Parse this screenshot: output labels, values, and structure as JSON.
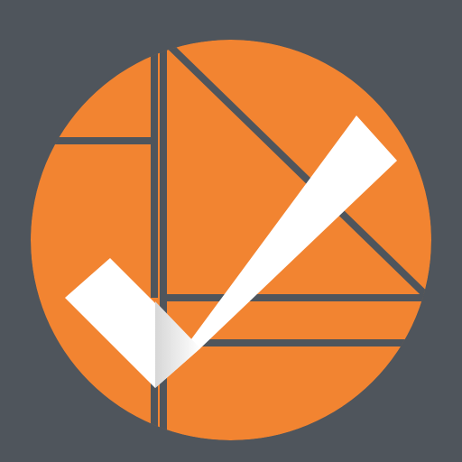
{
  "app_icon": {
    "icon": "checkmark-play-logo-icon",
    "colors": {
      "background": "#4f555c",
      "circle": "#f28431",
      "divider": "#4f555c",
      "check_mark": "#ffffff",
      "check_shadow": "#d7d7d7"
    }
  }
}
